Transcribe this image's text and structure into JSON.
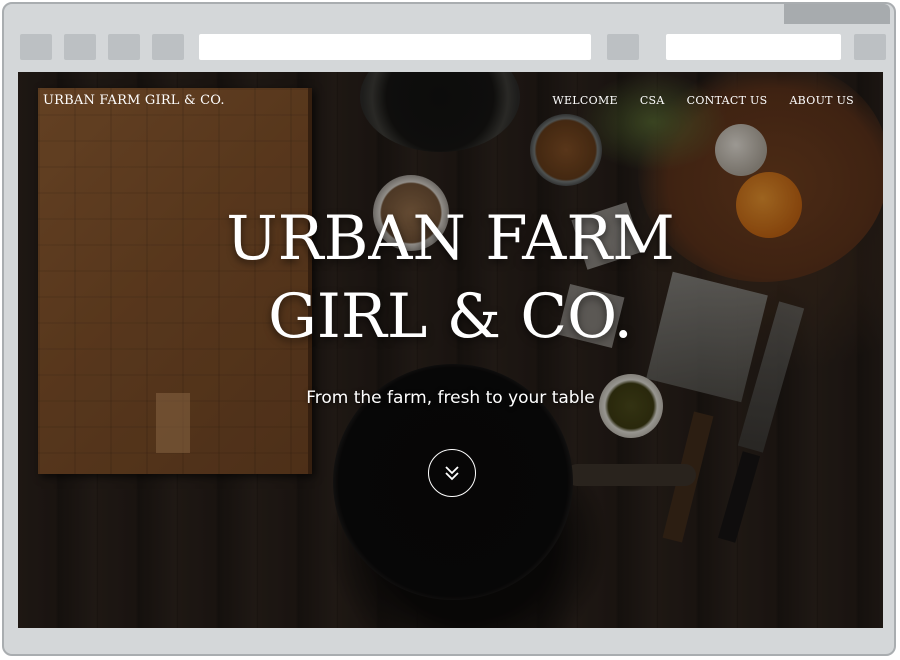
{
  "site": {
    "brand": "URBAN FARM GIRL & CO.",
    "nav": [
      "WELCOME",
      "CSA",
      "CONTACT US",
      "ABOUT US"
    ]
  },
  "hero": {
    "title_line1": "URBAN FARM",
    "title_line2": "GIRL & CO.",
    "tagline": "From the farm, fresh to your table",
    "scroll_icon": "chevron-double-down-icon"
  },
  "colors": {
    "frame": "#d4d7d9",
    "frame_dark": "#a7abae",
    "text": "#ffffff",
    "background_wood": "#241c17"
  }
}
